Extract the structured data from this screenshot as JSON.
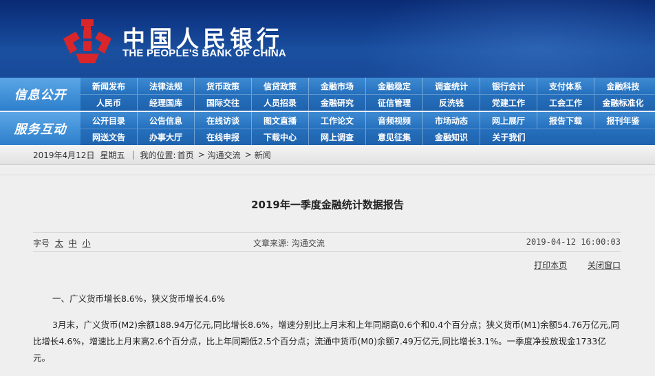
{
  "header": {
    "title_cn": "中国人民银行",
    "title_en": "THE PEOPLE'S BANK OF CHINA",
    "logo_icon": "pboc-logo-icon",
    "brand_red": "#d8262a",
    "brand_blue": "#113d8c"
  },
  "nav": {
    "section1": {
      "label": "信息公开",
      "row1": [
        "新闻发布",
        "法律法规",
        "货币政策",
        "信贷政策",
        "金融市场",
        "金融稳定",
        "调查统计",
        "银行会计",
        "支付体系",
        "金融科技"
      ],
      "row2": [
        "人民币",
        "经理国库",
        "国际交往",
        "人员招录",
        "金融研究",
        "征信管理",
        "反洗钱",
        "党建工作",
        "工会工作",
        "金融标准化"
      ]
    },
    "section2": {
      "label": "服务互动",
      "row1": [
        "公开目录",
        "公告信息",
        "在线访谈",
        "图文直播",
        "工作论文",
        "音频视频",
        "市场动态",
        "网上展厅",
        "报告下载",
        "报刊年鉴"
      ],
      "row2": [
        "网送文告",
        "办事大厅",
        "在线申报",
        "下载中心",
        "网上调查",
        "意见征集",
        "金融知识",
        "关于我们"
      ]
    }
  },
  "breadcrumb": {
    "date": "2019年4月12日",
    "weekday": "星期五",
    "sep": "|",
    "location_label": "我的位置:",
    "items": [
      "首页",
      "沟通交流",
      "新闻"
    ],
    "arrow": ">"
  },
  "article": {
    "title": "2019年一季度金融统计数据报告",
    "font_size_label": "字号",
    "font_sizes": [
      "太",
      "中",
      "小"
    ],
    "source": "文章来源: 沟通交流",
    "datetime": "2019-04-12  16:00:03",
    "print_label": "打印本页",
    "close_label": "关闭窗口",
    "heading1": "一、广义货币增长8.6%，狭义货币增长4.6%",
    "paragraph1": "3月末，广义货币(M2)余额188.94万亿元,同比增长8.6%，增速分别比上月末和上年同期高0.6个和0.4个百分点；狭义货币(M1)余额54.76万亿元,同比增长4.6%，增速比上月末高2.6个百分点，比上年同期低2.5个百分点；流通中货币(M0)余额7.49万亿元,同比增长3.1%。一季度净投放现金1733亿元。"
  }
}
